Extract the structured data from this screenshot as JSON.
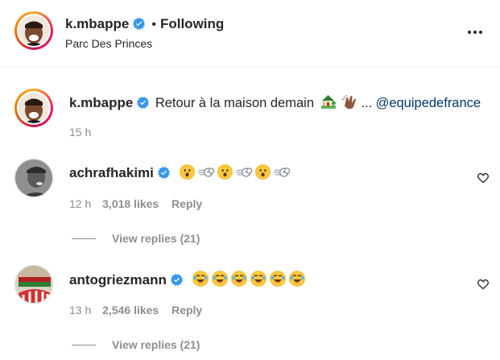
{
  "post_header": {
    "username": "k.mbappe",
    "separator": "•",
    "follow_status": "Following",
    "location": "Parc Des Princes",
    "more_icon": "more-horizontal-icon"
  },
  "caption": {
    "username": "k.mbappe",
    "text": "Retour à la maison demain",
    "emojis": [
      "house-with-garden",
      "clapping-hands"
    ],
    "ellipsis": "...",
    "mention": "@equipedefrance",
    "time": "15 h"
  },
  "comments": [
    {
      "username": "achrafhakimi",
      "emojis": [
        "hushed-face",
        "dashing-away",
        "hushed-face",
        "dashing-away",
        "hushed-face",
        "dashing-away"
      ],
      "time": "12 h",
      "likes": "3,018 likes",
      "reply_label": "Reply",
      "view_replies": "View replies (21)"
    },
    {
      "username": "antogriezmann",
      "emojis": [
        "face-with-tears-of-joy",
        "face-with-tears-of-joy",
        "face-with-tears-of-joy",
        "face-with-tears-of-joy",
        "face-with-tears-of-joy",
        "face-with-tears-of-joy"
      ],
      "time": "13 h",
      "likes": "2,546 likes",
      "reply_label": "Reply",
      "view_replies": "View replies (21)"
    }
  ],
  "colors": {
    "verified": "#3897f0",
    "mention": "#00376b",
    "muted": "#8e8e8e",
    "text": "#262626",
    "emoji_yellow": "#ffc83d"
  }
}
